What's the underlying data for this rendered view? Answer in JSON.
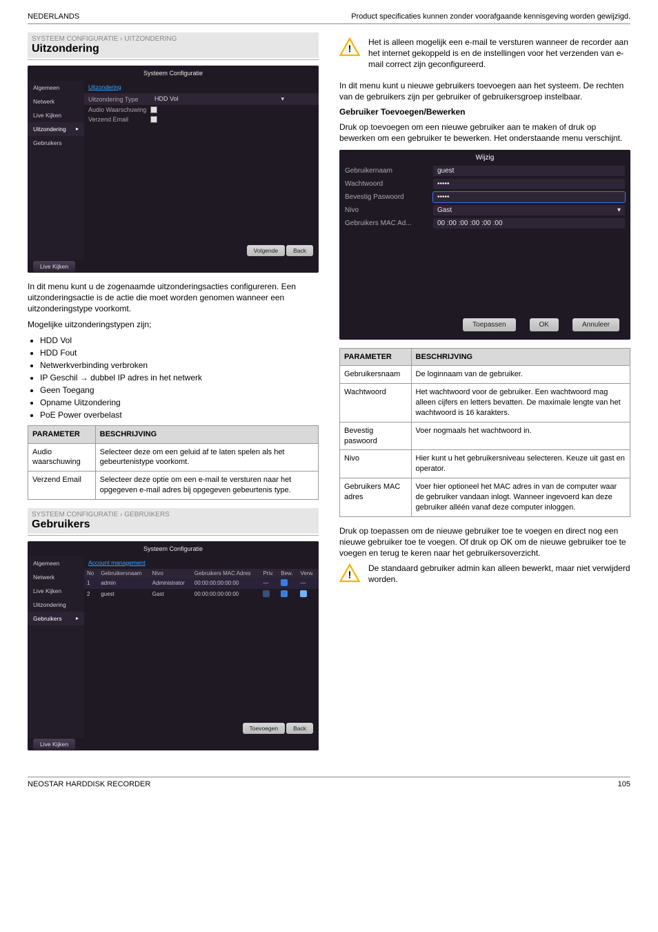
{
  "header": {
    "left": "NEDERLANDS",
    "right": "Product specificaties kunnen zonder voorafgaande kennisgeving worden gewijzigd."
  },
  "footer": {
    "left": "NEOSTAR HARDDISK RECORDER",
    "right": "105"
  },
  "left": {
    "sec1": {
      "kicker": "SYSTEEM CONFIGURATIE › UITZONDERING",
      "title": "Uitzondering",
      "panel": {
        "title": "Systeem Configuratie",
        "side": [
          "Algemeen",
          "Netwerk",
          "Live Kijken",
          "Uitzondering",
          "Gebruikers"
        ],
        "side_sel": 3,
        "breadcrumb": "Uitzondering",
        "rows": {
          "type_label": "Uitzondering Type",
          "type_value": "HDD Vol",
          "audio_label": "Audio Waarschuwing",
          "email_label": "Verzend Email"
        },
        "btn_next": "Volgende",
        "btn_back": "Back",
        "footer_btn": "Live Kijken"
      },
      "body_p1": "In dit menu kunt u de zogenaamde uitzonderingsacties configureren. Een uitzonderingsactie is de actie die moet worden genomen wanneer een uitzonderingstype voorkomt.",
      "body_p2": "Mogelijke uitzonderingstypen zijn;",
      "bullets": [
        "HDD Vol",
        "HDD Fout",
        "Netwerkverbinding verbroken",
        "IP Geschil → dubbel IP adres in het netwerk",
        "Geen Toegang",
        "Opname Uitzondering",
        "PoE Power overbelast"
      ],
      "table": {
        "h1": "PARAMETER",
        "h2": "BESCHRIJVING",
        "r1c1": "Audio waarschuwing",
        "r1c2": "Selecteer deze om een geluid af te laten spelen als het gebeurtenistype voorkomt.",
        "r2c1": "Verzend Email",
        "r2c2": "Selecteer deze optie om een e-mail te versturen naar het opgegeven e-mail adres bij opgegeven gebeurtenis type."
      }
    },
    "sec2": {
      "kicker": "SYSTEEM CONFIGURATIE › GEBRUIKERS",
      "title": "Gebruikers",
      "panel": {
        "title": "Systeem Configuratie",
        "side": [
          "Algemeen",
          "Netwerk",
          "Live Kijken",
          "Uitzondering",
          "Gebruikers"
        ],
        "side_sel": 4,
        "breadcrumb": "Account management",
        "tbl": {
          "headers": [
            "No",
            "Gebruikersnaam",
            "Nivo",
            "Gebruikers MAC Adres",
            "",
            "Priv.",
            "Bew.",
            "Verw."
          ],
          "rows": [
            {
              "no": "1",
              "user": "admin",
              "nivo": "Administrator",
              "mac": "00:00:00:00:00:00",
              "sel": true
            },
            {
              "no": "2",
              "user": "guest",
              "nivo": "Gast",
              "mac": "00:00:00:00:00:00",
              "sel": false
            }
          ]
        },
        "btn_add": "Toevoegen",
        "btn_back": "Back",
        "footer_btn": "Live Kijken"
      }
    }
  },
  "right": {
    "warn1": "Het is alleen mogelijk een e-mail te versturen wanneer de recorder aan het internet gekoppeld is en de instellingen voor het verzenden van e-mail correct zijn geconfigureerd.",
    "p1": "In dit menu kunt u nieuwe gebruikers toevoegen aan het systeem. De rechten van de gebruikers zijn per gebruiker of gebruikersgroep instelbaar.",
    "add_title": "Gebruiker Toevoegen/Bewerken",
    "p2": "Druk op toevoegen om een nieuwe gebruiker aan te maken of druk op bewerken om een gebruiker te bewerken. Het onderstaande menu verschijnt.",
    "modal": {
      "title": "Wijzig",
      "rows": [
        {
          "label": "Gebruikernaam",
          "value": "guest"
        },
        {
          "label": "Wachtwoord",
          "value": "•••••"
        },
        {
          "label": "Bevestig Paswoord",
          "value": "•••••",
          "selected": true
        },
        {
          "label": "Nivo",
          "value": "Gast",
          "dropdown": true
        },
        {
          "label": "Gebruikers MAC Ad...",
          "value": "00 :00 :00 :00 :00 :00"
        }
      ],
      "btn_apply": "Toepassen",
      "btn_ok": "OK",
      "btn_cancel": "Annuleer"
    },
    "table": {
      "h1": "PARAMETER",
      "h2": "BESCHRIJVING",
      "rows": [
        {
          "k": "Gebruikersnaam",
          "v": "De loginnaam van de gebruiker."
        },
        {
          "k": "Wachtwoord",
          "v": "Het wachtwoord voor de gebruiker. Een wachtwoord mag alleen cijfers en letters bevatten. De maximale lengte van het wachtwoord is 16 karakters."
        },
        {
          "k": "Bevestig paswoord",
          "v": "Voer nogmaals het wachtwoord in."
        },
        {
          "k": "Nivo",
          "v": "Hier kunt u het gebruikersniveau selecteren. Keuze uit gast en operator."
        },
        {
          "k": "Gebruikers MAC adres",
          "v": "Voer hier optioneel het MAC adres in van de computer waar de gebruiker vandaan inlogt. Wanneer ingevoerd kan deze gebruiker alléén vanaf deze computer inloggen."
        }
      ]
    },
    "p3": "Druk op toepassen om de nieuwe gebruiker toe te voegen en direct nog een nieuwe gebruiker toe te voegen. Of druk op OK om de nieuwe gebruiker toe te voegen en terug te keren naar het gebruikersoverzicht.",
    "warn2": "De standaard gebruiker admin kan alleen bewerkt, maar niet verwijderd worden."
  }
}
